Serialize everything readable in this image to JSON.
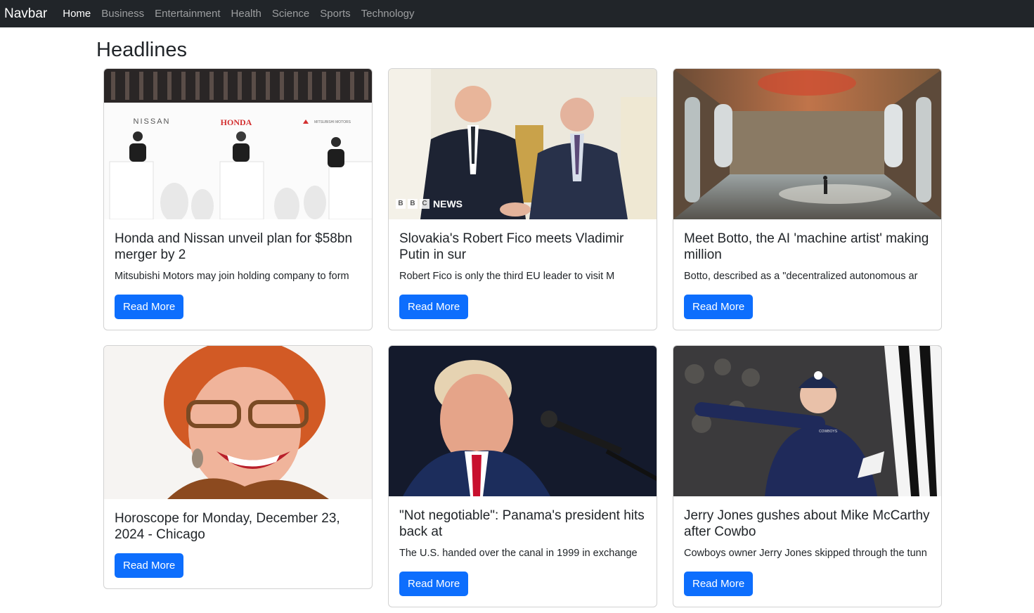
{
  "navbar": {
    "brand": "Navbar",
    "links": [
      "Home",
      "Business",
      "Entertainment",
      "Health",
      "Science",
      "Sports",
      "Technology"
    ]
  },
  "page": {
    "heading": "Headlines"
  },
  "cards": [
    {
      "title": "Honda and Nissan unveil plan for $58bn merger by 2",
      "text": "Mitsubishi Motors may join holding company to form",
      "button": "Read More",
      "image_labels": [
        "NISSAN",
        "HONDA",
        "MITSUBISHI MOTORS"
      ]
    },
    {
      "title": "Slovakia's Robert Fico meets Vladimir Putin in sur",
      "text": "Robert Fico is only the third EU leader to visit M",
      "button": "Read More",
      "image_labels": [
        "B",
        "B",
        "C",
        "NEWS"
      ]
    },
    {
      "title": "Meet Botto, the AI 'machine artist' making million",
      "text": "Botto, described as a \"decentralized autonomous ar",
      "button": "Read More"
    },
    {
      "title": "Horoscope for Monday, December 23, 2024 - Chicago",
      "text": "",
      "button": "Read More"
    },
    {
      "title": "\"Not negotiable\": Panama's president hits back at",
      "text": "The U.S. handed over the canal in 1999 in exchange",
      "button": "Read More"
    },
    {
      "title": "Jerry Jones gushes about Mike McCarthy after Cowbo",
      "text": "Cowboys owner Jerry Jones skipped through the tunn",
      "button": "Read More",
      "image_labels": [
        "COWBOYS"
      ]
    }
  ]
}
